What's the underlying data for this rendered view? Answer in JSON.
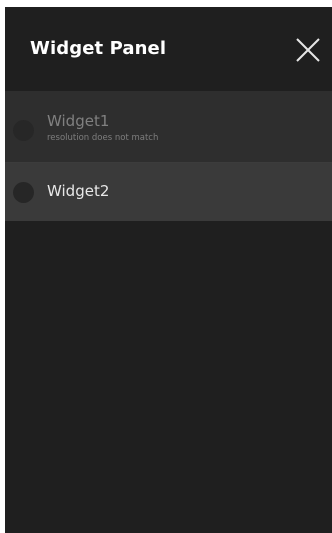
{
  "panel": {
    "title": "Widget Panel",
    "close_icon": "close-icon",
    "colors": {
      "background": "#1f1f1f",
      "disabled_item_bg": "#2e2e2e",
      "enabled_item_bg": "#3a3a3a",
      "title_text": "#ffffff"
    }
  },
  "widgets": [
    {
      "name": "Widget1",
      "status": "resolution does not match",
      "enabled": false
    },
    {
      "name": "Widget2",
      "enabled": true
    }
  ]
}
